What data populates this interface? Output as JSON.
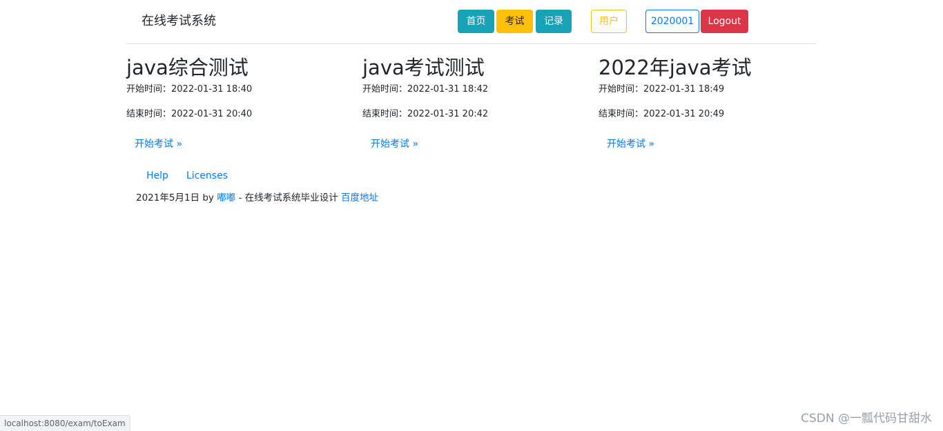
{
  "navbar": {
    "brand": "在线考试系统",
    "buttons": {
      "home": "首页",
      "exam": "考试",
      "records": "记录",
      "user": "用户",
      "user_id": "2020001",
      "logout": "Logout"
    }
  },
  "exams": [
    {
      "title": "java综合测试",
      "start": "开始时间：2022-01-31 18:40",
      "end": "结束时间：2022-01-31 20:40",
      "link": "开始考试 »"
    },
    {
      "title": "java考试测试",
      "start": "开始时间：2022-01-31 18:42",
      "end": "结束时间：2022-01-31 20:42",
      "link": "开始考试 »"
    },
    {
      "title": "2022年java考试",
      "start": "开始时间：2022-01-31 18:49",
      "end": "结束时间：2022-01-31 20:49",
      "link": "开始考试 »"
    }
  ],
  "footer": {
    "help": "Help",
    "licenses": "Licenses",
    "date_by": "2021年5月1日 by",
    "author": "嘟嘟",
    "description": "- 在线考试系统毕业设计",
    "baidu_link": "百度地址"
  },
  "statusbar": {
    "url": "localhost:8080/exam/toExam"
  },
  "watermark": "CSDN @一瓢代码甘甜水"
}
